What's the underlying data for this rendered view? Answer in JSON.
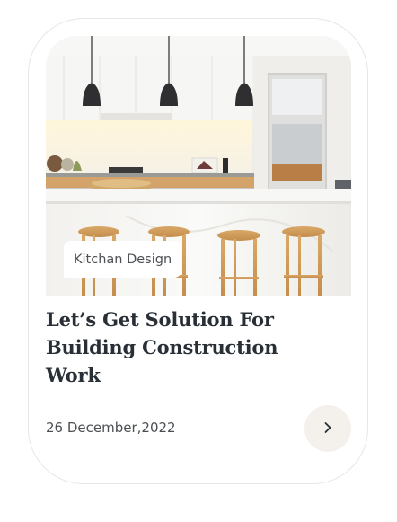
{
  "card": {
    "tag": "Kitchan Design",
    "title": "Let’s Get Solution For Building Construction Work",
    "date": "26 December,2022"
  },
  "icons": {
    "arrow": "chevron-right-icon"
  },
  "colors": {
    "title": "#292f36",
    "text": "#4d5053",
    "button_bg": "#f4f0ec",
    "card_border": "#e6e6e6"
  }
}
